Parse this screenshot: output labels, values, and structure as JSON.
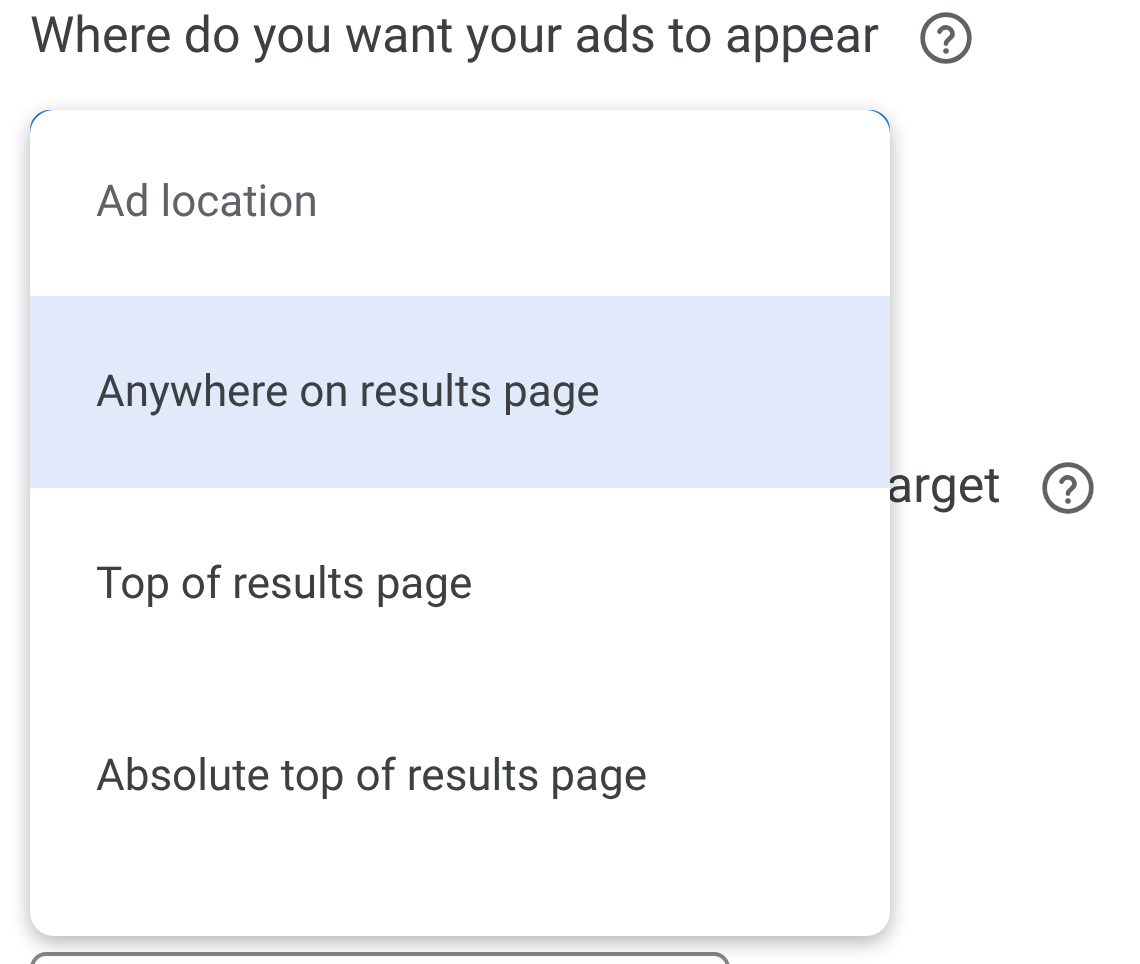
{
  "heading": {
    "text": "Where do you want your ads to appear"
  },
  "second_label": {
    "text": "arget"
  },
  "menu": {
    "header": "Ad location",
    "items": [
      {
        "label": "Anywhere on results page",
        "selected": true
      },
      {
        "label": "Top of results page",
        "selected": false
      },
      {
        "label": "Absolute top of results page",
        "selected": false
      }
    ]
  }
}
